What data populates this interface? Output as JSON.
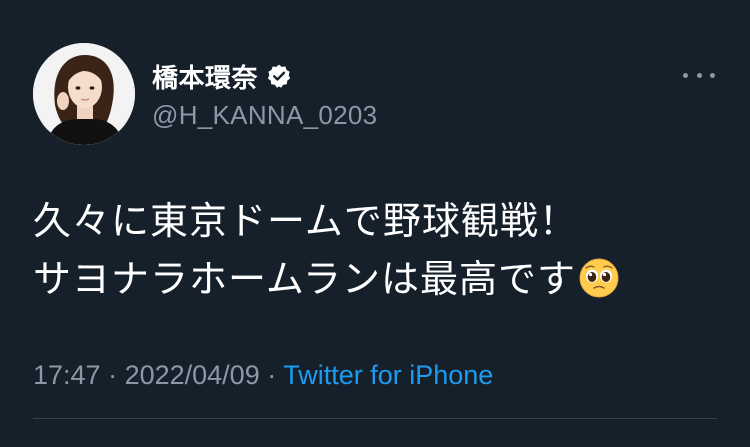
{
  "colors": {
    "background": "#15202b",
    "text_primary": "#ffffff",
    "text_secondary": "#8b98a5",
    "link": "#1d9bf0",
    "verified_badge": "#ffffff",
    "divider": "#38444d"
  },
  "author": {
    "display_name": "橋本環奈",
    "handle": "@H_KANNA_0203",
    "verified": true,
    "avatar_icon": "profile-photo",
    "verified_icon": "verified-badge-icon"
  },
  "more_icon": "more-options-icon",
  "tweet": {
    "lines": [
      "久々に東京ドームで野球観戦！",
      "サヨナラホームランは最高です"
    ],
    "emoji": "pleading-face-emoji"
  },
  "meta": {
    "time": "17:47",
    "separator_1": " · ",
    "date": "2022/04/09",
    "separator_2": " · ",
    "source": "Twitter for iPhone"
  }
}
